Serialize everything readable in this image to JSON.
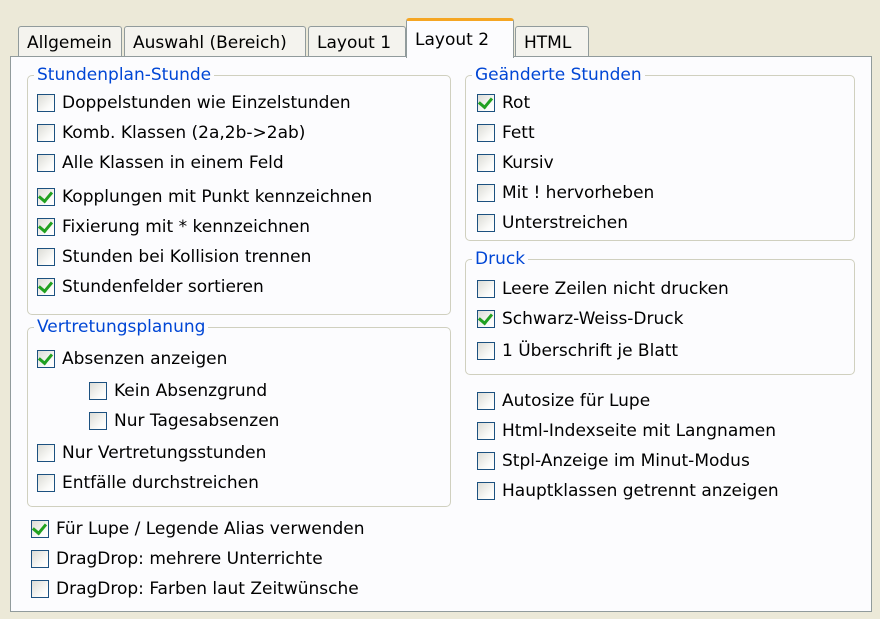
{
  "tabs": [
    {
      "label": "Allgemein",
      "active": false
    },
    {
      "label": "Auswahl (Bereich)",
      "active": false
    },
    {
      "label": "Layout 1",
      "active": false
    },
    {
      "label": "Layout 2",
      "active": true
    },
    {
      "label": "HTML",
      "active": false
    }
  ],
  "groups": {
    "stundenplan": {
      "title": "Stundenplan-Stunde",
      "items": [
        {
          "label": "Doppelstunden wie Einzelstunden",
          "checked": false
        },
        {
          "label": "Komb. Klassen (2a,2b->2ab)",
          "checked": false
        },
        {
          "label": "Alle Klassen in einem Feld",
          "checked": false
        },
        {
          "label": "Kopplungen mit Punkt kennzeichnen",
          "checked": true
        },
        {
          "label": "Fixierung mit * kennzeichnen",
          "checked": true
        },
        {
          "label": "Stunden bei Kollision trennen",
          "checked": false
        },
        {
          "label": "Stundenfelder sortieren",
          "checked": true
        }
      ]
    },
    "vertretung": {
      "title": "Vertretungsplanung",
      "items": [
        {
          "label": "Absenzen anzeigen",
          "checked": true
        },
        {
          "label": "Kein Absenzgrund",
          "checked": false
        },
        {
          "label": "Nur Tagesabsenzen",
          "checked": false
        },
        {
          "label": "Nur Vertretungsstunden",
          "checked": false
        },
        {
          "label": "Entfälle durchstreichen",
          "checked": false
        }
      ]
    },
    "geaendert": {
      "title": "Geänderte Stunden",
      "items": [
        {
          "label": "Rot",
          "checked": true
        },
        {
          "label": "Fett",
          "checked": false
        },
        {
          "label": "Kursiv",
          "checked": false
        },
        {
          "label": "Mit ! hervorheben",
          "checked": false
        },
        {
          "label": "Unterstreichen",
          "checked": false
        }
      ]
    },
    "druck": {
      "title": "Druck",
      "items": [
        {
          "label": "Leere Zeilen nicht drucken",
          "checked": false
        },
        {
          "label": "Schwarz-Weiss-Druck",
          "checked": true
        },
        {
          "label": "1 Überschrift je Blatt",
          "checked": false
        }
      ]
    }
  },
  "loose_left": [
    {
      "label": "Für Lupe / Legende Alias verwenden",
      "checked": true
    },
    {
      "label": "DragDrop: mehrere Unterrichte",
      "checked": false
    },
    {
      "label": "DragDrop: Farben laut Zeitwünsche",
      "checked": false
    }
  ],
  "loose_right": [
    {
      "label": "Autosize für Lupe",
      "checked": false
    },
    {
      "label": "Html-Indexseite mit Langnamen",
      "checked": false
    },
    {
      "label": "Stpl-Anzeige im Minut-Modus",
      "checked": false
    },
    {
      "label": "Hauptklassen getrennt anzeigen",
      "checked": false
    }
  ],
  "colors": {
    "legend": "#0046d5",
    "check": "#21a121",
    "active_tab_accent": "#f5a623"
  }
}
